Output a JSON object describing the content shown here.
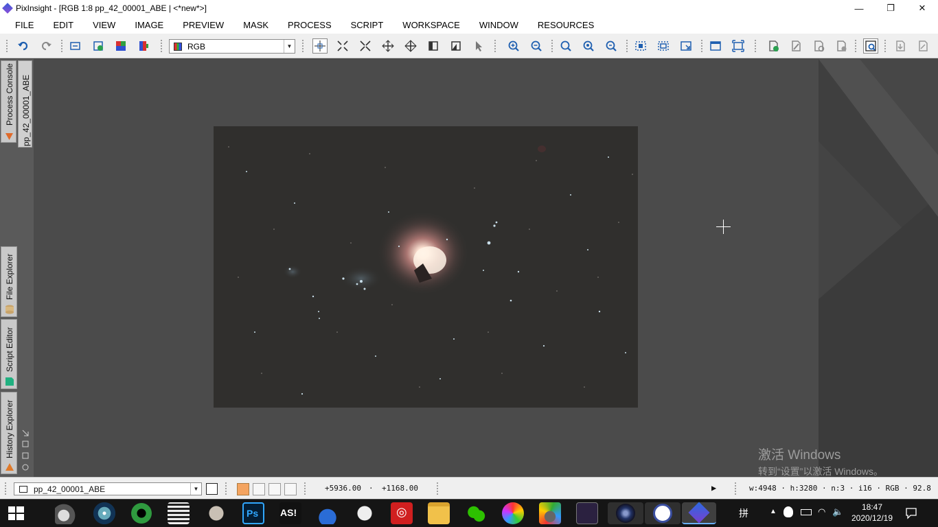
{
  "window": {
    "app_name": "PixInsight",
    "title": "[RGB 1:8 pp_42_00001_ABE | <*new*>]",
    "minimize": "—",
    "restore": "❐",
    "close": "✕"
  },
  "menu": [
    "FILE",
    "EDIT",
    "VIEW",
    "IMAGE",
    "PREVIEW",
    "MASK",
    "PROCESS",
    "SCRIPT",
    "WORKSPACE",
    "WINDOW",
    "RESOURCES"
  ],
  "toolbar": {
    "channel_select": "RGB",
    "icons": [
      "undo-icon",
      "redo-icon",
      "identifier-icon",
      "new-image-icon",
      "rgb-extract-icon",
      "rgb-combine-icon",
      "readout-mode-icon",
      "zoom-in-fit-icon",
      "pan-mode-icon",
      "move-icon",
      "center-icon",
      "fit-view-icon",
      "fit-image-icon",
      "pointer-icon",
      "zoom-in-icon",
      "zoom-out-icon",
      "zoom-1-1-icon",
      "zoom-plus-icon",
      "zoom-minus-icon",
      "select-preview-icon",
      "new-preview-icon",
      "fit-window-icon",
      "maximize-view-icon",
      "full-screen-icon",
      "new-mask-icon",
      "edit-mask-icon",
      "mask-visible-icon",
      "invert-mask-icon",
      "star-alignment-icon",
      "screen-transfer-icon"
    ]
  },
  "side_tabs": {
    "process_console": "Process Console",
    "view_tab": "pp_42_00001_ABE",
    "file_explorer": "File Explorer",
    "script_editor": "Script Editor",
    "history_explorer": "History Explorer"
  },
  "watermark": {
    "line1": "激活 Windows",
    "line2": "转到“设置”以激活 Windows。"
  },
  "statusbar": {
    "view_name": "pp_42_00001_ABE",
    "coord_x": "+5936.00",
    "coord_sep": "·",
    "coord_y": "+1168.00",
    "play": "▶",
    "info": "w:4948 · h:3280 · n:3 · i16 · RGB · 92.8"
  },
  "taskbar": {
    "apps": [
      "terminal-app",
      "deep-sky-app",
      "phd-guiding-app",
      "sharpcap-app",
      "stellarium-app",
      "photoshop-app",
      "asi-studio-app",
      "nighttime-imaging-app",
      "sky-globe-app",
      "netease-music-app",
      "file-explorer-app",
      "wechat-app",
      "browser-app",
      "notes-app",
      "camera-app",
      "deep-sky-stacker-app",
      "observatory-app",
      "pixinsight-app"
    ],
    "ime": "拼",
    "time": "18:47",
    "date": "2020/12/19"
  },
  "colors": {
    "workspace": "#4b4b4b",
    "side_panel": "#5a5a5a",
    "taskbar": "#151515",
    "toolbar": "#efefef"
  }
}
